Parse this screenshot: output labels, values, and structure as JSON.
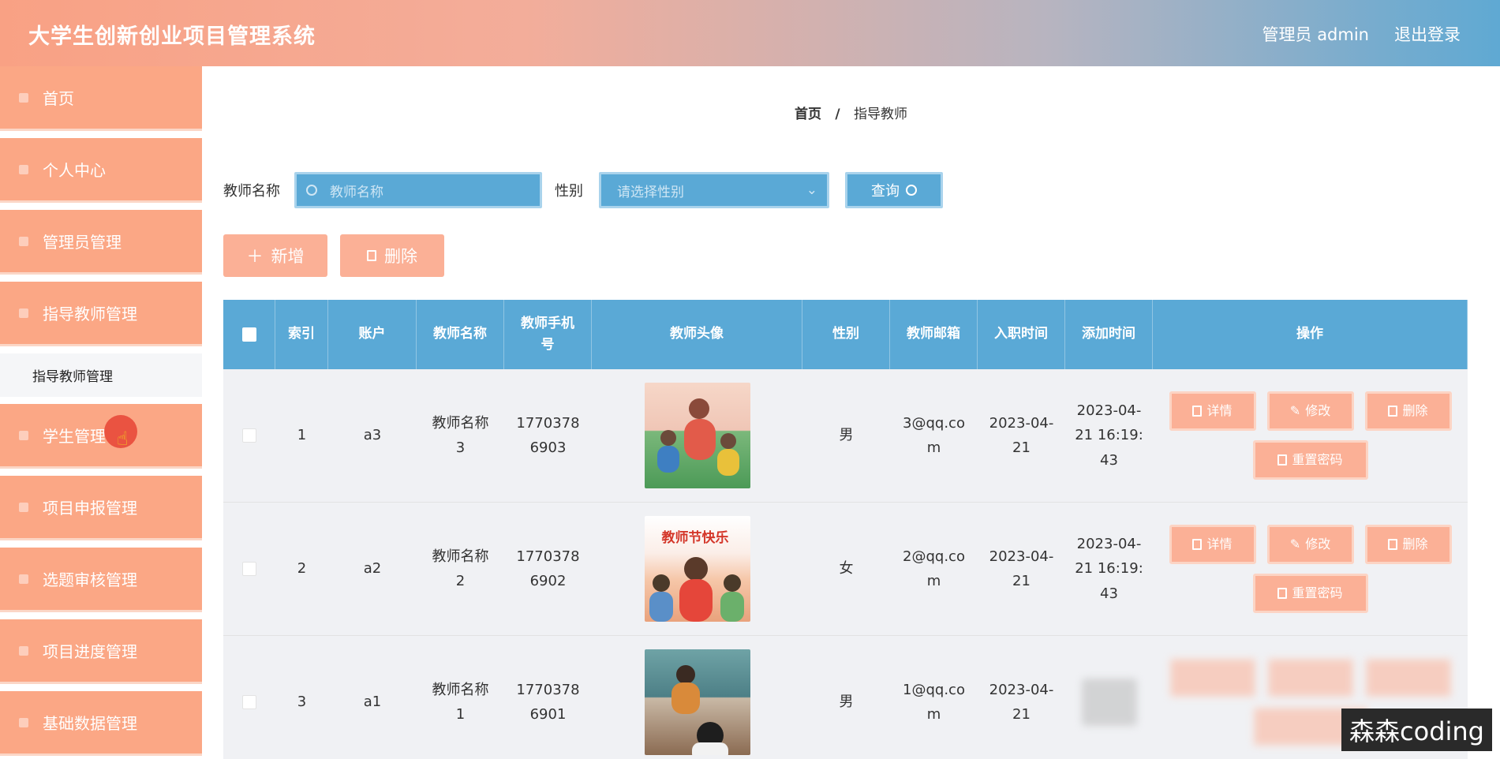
{
  "app": {
    "title": "大学生创新创业项目管理系统"
  },
  "topbar": {
    "user_label": "管理员 admin",
    "logout_label": "退出登录"
  },
  "sidebar": {
    "items": [
      {
        "label": "首页"
      },
      {
        "label": "个人中心"
      },
      {
        "label": "管理员管理"
      },
      {
        "label": "指导教师管理"
      },
      {
        "label": "学生管理"
      },
      {
        "label": "项目申报管理"
      },
      {
        "label": "选题审核管理"
      },
      {
        "label": "项目进度管理"
      },
      {
        "label": "基础数据管理"
      }
    ],
    "submenu": {
      "label": "指导教师管理"
    }
  },
  "breadcrumb": {
    "home": "首页",
    "separator": "/",
    "current": "指导教师"
  },
  "search": {
    "name_label": "教师名称",
    "name_placeholder": "教师名称",
    "gender_label": "性别",
    "gender_placeholder": "请选择性别",
    "query_label": "查询"
  },
  "actions": {
    "add_label": "新增",
    "delete_label": "删除"
  },
  "table": {
    "headers": {
      "index": "索引",
      "account": "账户",
      "name": "教师名称",
      "phone": "教师手机号",
      "avatar": "教师头像",
      "gender": "性别",
      "email": "教师邮箱",
      "hire_date": "入职时间",
      "added_time": "添加时间",
      "ops": "操作"
    },
    "rows": [
      {
        "index": "1",
        "account": "a3",
        "name": "教师名称3",
        "phone": "17703786903",
        "avatar_text": "",
        "gender": "男",
        "email": "3@qq.com",
        "hire_date": "2023-04-21",
        "added_time": "2023-04-21 16:19:43"
      },
      {
        "index": "2",
        "account": "a2",
        "name": "教师名称2",
        "phone": "17703786902",
        "avatar_text": "教师节快乐",
        "gender": "女",
        "email": "2@qq.com",
        "hire_date": "2023-04-21",
        "added_time": "2023-04-21 16:19:43"
      },
      {
        "index": "3",
        "account": "a1",
        "name": "教师名称1",
        "phone": "17703786901",
        "avatar_text": "",
        "gender": "男",
        "email": "1@qq.com",
        "hire_date": "2023-04-21",
        "added_time": ""
      }
    ],
    "op_labels": {
      "detail": "详情",
      "edit": "修改",
      "delete": "删除",
      "reset": "重置密码"
    }
  },
  "watermark": "森森coding",
  "colors": {
    "accent_orange": "#fba785",
    "accent_blue": "#5aa9d6"
  }
}
